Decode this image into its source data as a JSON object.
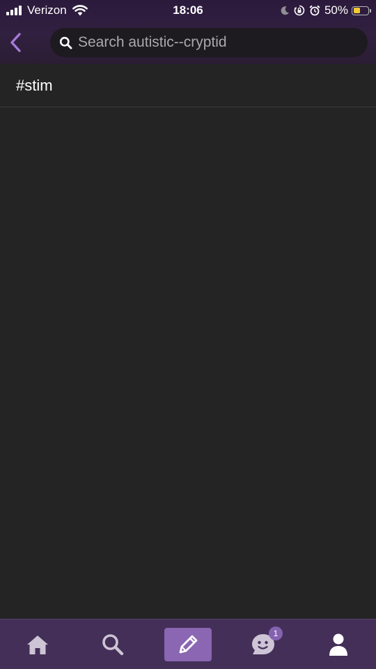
{
  "status_bar": {
    "carrier": "Verizon",
    "time": "18:06",
    "battery_percent": "50%",
    "battery_level": 0.5,
    "icons": [
      "signal-icon",
      "wifi-icon",
      "moon-icon",
      "orientation-lock-icon",
      "alarm-icon",
      "battery-icon"
    ]
  },
  "header": {
    "back_icon": "chevron-left-icon",
    "search_icon": "search-icon",
    "search_placeholder": "Search autistic--cryptid",
    "search_value": ""
  },
  "results": [
    {
      "label": "#stim"
    }
  ],
  "bottom_nav": {
    "items": [
      {
        "icon": "home-icon"
      },
      {
        "icon": "search-icon"
      },
      {
        "icon": "pencil-icon"
      },
      {
        "icon": "chat-face-icon",
        "badge": "1"
      },
      {
        "icon": "person-icon"
      }
    ]
  },
  "colors": {
    "header_bg": "#2c1a3d",
    "content_bg": "#242424",
    "accent": "#a57bd9",
    "nav_bg": "#442f58",
    "compose_bg": "#8a66b3",
    "battery_fill": "#f5c933"
  }
}
